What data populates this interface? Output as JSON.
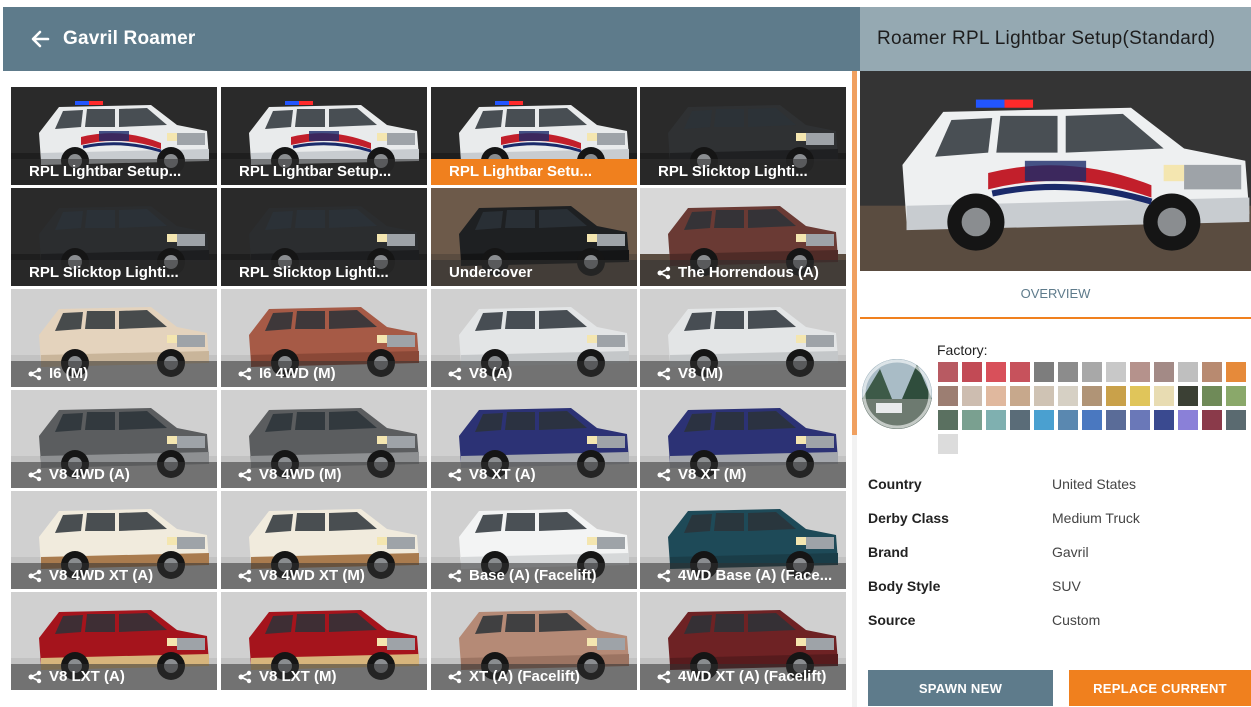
{
  "left_header": {
    "back_icon": "arrow-left-icon",
    "title": "Gavril Roamer"
  },
  "tiles": [
    {
      "label": "RPL Lightbar Setup...",
      "config": false,
      "body": "#e9ebec",
      "trim": "#c8ccd0",
      "bg": "#2a2a2a",
      "police": true,
      "lights": true
    },
    {
      "label": "RPL Lightbar Setup...",
      "config": false,
      "body": "#e9ebec",
      "trim": "#c8ccd0",
      "bg": "#2a2a2a",
      "police": true,
      "lights": true
    },
    {
      "label": "RPL Lightbar Setu...",
      "config": false,
      "body": "#e9ebec",
      "trim": "#c8ccd0",
      "bg": "#2a2a2a",
      "police": true,
      "lights": true,
      "selected": true
    },
    {
      "label": "RPL Slicktop Lighti...",
      "config": false,
      "body": "#2f3133",
      "trim": "#1f2022",
      "bg": "#2a2a2a",
      "police": false,
      "lights": false
    },
    {
      "label": "RPL Slicktop Lighti...",
      "config": false,
      "body": "#2b2d2f",
      "trim": "#1d1e20",
      "bg": "#2a2a2a",
      "police": false,
      "lights": false
    },
    {
      "label": "RPL Slicktop Lighti...",
      "config": false,
      "body": "#2b2d2f",
      "trim": "#1d1e20",
      "bg": "#2a2a2a",
      "police": false,
      "lights": false
    },
    {
      "label": "Undercover",
      "config": false,
      "body": "#1e2022",
      "trim": "#141516",
      "bg": "#6d5a4a",
      "police": false,
      "lights": false
    },
    {
      "label": "The Horrendous (A)",
      "config": true,
      "body": "#6a3a34",
      "trim": "#4f2b27",
      "bg": "#d8d8d8",
      "police": false,
      "lights": false
    },
    {
      "label": "I6 (M)",
      "config": true,
      "body": "#e4d3bd",
      "trim": "#c9b59a",
      "bg": "#d0d0d0",
      "police": false,
      "lights": false
    },
    {
      "label": "I6 4WD (M)",
      "config": true,
      "body": "#a65a46",
      "trim": "#8a4837",
      "bg": "#d0d0d0",
      "police": false,
      "lights": false
    },
    {
      "label": "V8 (A)",
      "config": true,
      "body": "#e3e5e6",
      "trim": "#c4c7c9",
      "bg": "#d0d0d0",
      "police": false,
      "lights": false
    },
    {
      "label": "V8 (M)",
      "config": true,
      "body": "#e3e5e6",
      "trim": "#c4c7c9",
      "bg": "#d0d0d0",
      "police": false,
      "lights": false
    },
    {
      "label": "V8 4WD (A)",
      "config": true,
      "body": "#5b5d5f",
      "trim": "#8e9092",
      "bg": "#d0d0d0",
      "police": false,
      "lights": false
    },
    {
      "label": "V8 4WD (M)",
      "config": true,
      "body": "#5b5d5f",
      "trim": "#8e9092",
      "bg": "#d0d0d0",
      "police": false,
      "lights": false
    },
    {
      "label": "V8 XT (A)",
      "config": true,
      "body": "#2c3275",
      "trim": "#a4a7ad",
      "bg": "#d0d0d0",
      "police": false,
      "lights": false
    },
    {
      "label": "V8 XT (M)",
      "config": true,
      "body": "#2c3275",
      "trim": "#a4a7ad",
      "bg": "#d0d0d0",
      "police": false,
      "lights": false
    },
    {
      "label": "V8 4WD XT (A)",
      "config": true,
      "body": "#f1ebdd",
      "trim": "#a97b4e",
      "bg": "#d0d0d0",
      "police": false,
      "lights": false
    },
    {
      "label": "V8 4WD XT (M)",
      "config": true,
      "body": "#f1ebdd",
      "trim": "#a97b4e",
      "bg": "#d0d0d0",
      "police": false,
      "lights": false
    },
    {
      "label": "Base (A) (Facelift)",
      "config": true,
      "body": "#f3f4f4",
      "trim": "#d6d8d9",
      "bg": "#d0d0d0",
      "police": false,
      "lights": false
    },
    {
      "label": "4WD Base (A) (Face...",
      "config": true,
      "body": "#1e4a58",
      "trim": "#1a3d48",
      "bg": "#d0d0d0",
      "police": false,
      "lights": false
    },
    {
      "label": "V8 LXT (A)",
      "config": true,
      "body": "#a5141c",
      "trim": "#d7b57c",
      "bg": "#d0d0d0",
      "police": false,
      "lights": false
    },
    {
      "label": "V8 LXT (M)",
      "config": true,
      "body": "#a5141c",
      "trim": "#d7b57c",
      "bg": "#d0d0d0",
      "police": false,
      "lights": false
    },
    {
      "label": "XT (A) (Facelift)",
      "config": true,
      "body": "#b58a76",
      "trim": "#9c7462",
      "bg": "#d0d0d0",
      "police": false,
      "lights": false
    },
    {
      "label": "4WD XT (A) (Facelift)",
      "config": true,
      "body": "#6e2224",
      "trim": "#571b1d",
      "bg": "#d0d0d0",
      "police": false,
      "lights": false
    }
  ],
  "right_header": {
    "title": "Roamer RPL Lightbar Setup(Standard)"
  },
  "tab": {
    "overview": "OVERVIEW"
  },
  "factory": {
    "label": "Factory:",
    "swatches": [
      "#b85a62",
      "#c24a55",
      "#d8505a",
      "#c7525c",
      "#7d7d7d",
      "#8c8c8c",
      "#a8a8a8",
      "#c8c8c8",
      "#b5928c",
      "#a38a86",
      "#bfbfbf",
      "#b88a70",
      "#e68a3a",
      "#9c7e72",
      "#cdbdb0",
      "#e0b89e",
      "#c7a88c",
      "#cfc3b4",
      "#d6d0c4",
      "#b09476",
      "#c9a14a",
      "#e0c55a",
      "#e8dcb2",
      "#3b4034",
      "#6f8a58",
      "#8aa86a",
      "#5a7060",
      "#7aa090",
      "#7fb0b0",
      "#5a6c78",
      "#4aa0d0",
      "#5a88b0",
      "#4a78c0",
      "#5a6c98",
      "#6a78b8",
      "#3a4a90",
      "#8a80d8",
      "#8a3a4a",
      "#5a6a70",
      "#dcdcdc"
    ]
  },
  "info": [
    {
      "key": "Country",
      "value": "United States"
    },
    {
      "key": "Derby Class",
      "value": "Medium Truck"
    },
    {
      "key": "Brand",
      "value": "Gavril"
    },
    {
      "key": "Body Style",
      "value": "SUV"
    },
    {
      "key": "Source",
      "value": "Custom"
    }
  ],
  "buttons": {
    "spawn": "SPAWN NEW",
    "replace": "REPLACE CURRENT"
  },
  "colors": {
    "accent": "#f0801e",
    "header": "#5e7b8b",
    "header_right": "#95a9b2"
  }
}
